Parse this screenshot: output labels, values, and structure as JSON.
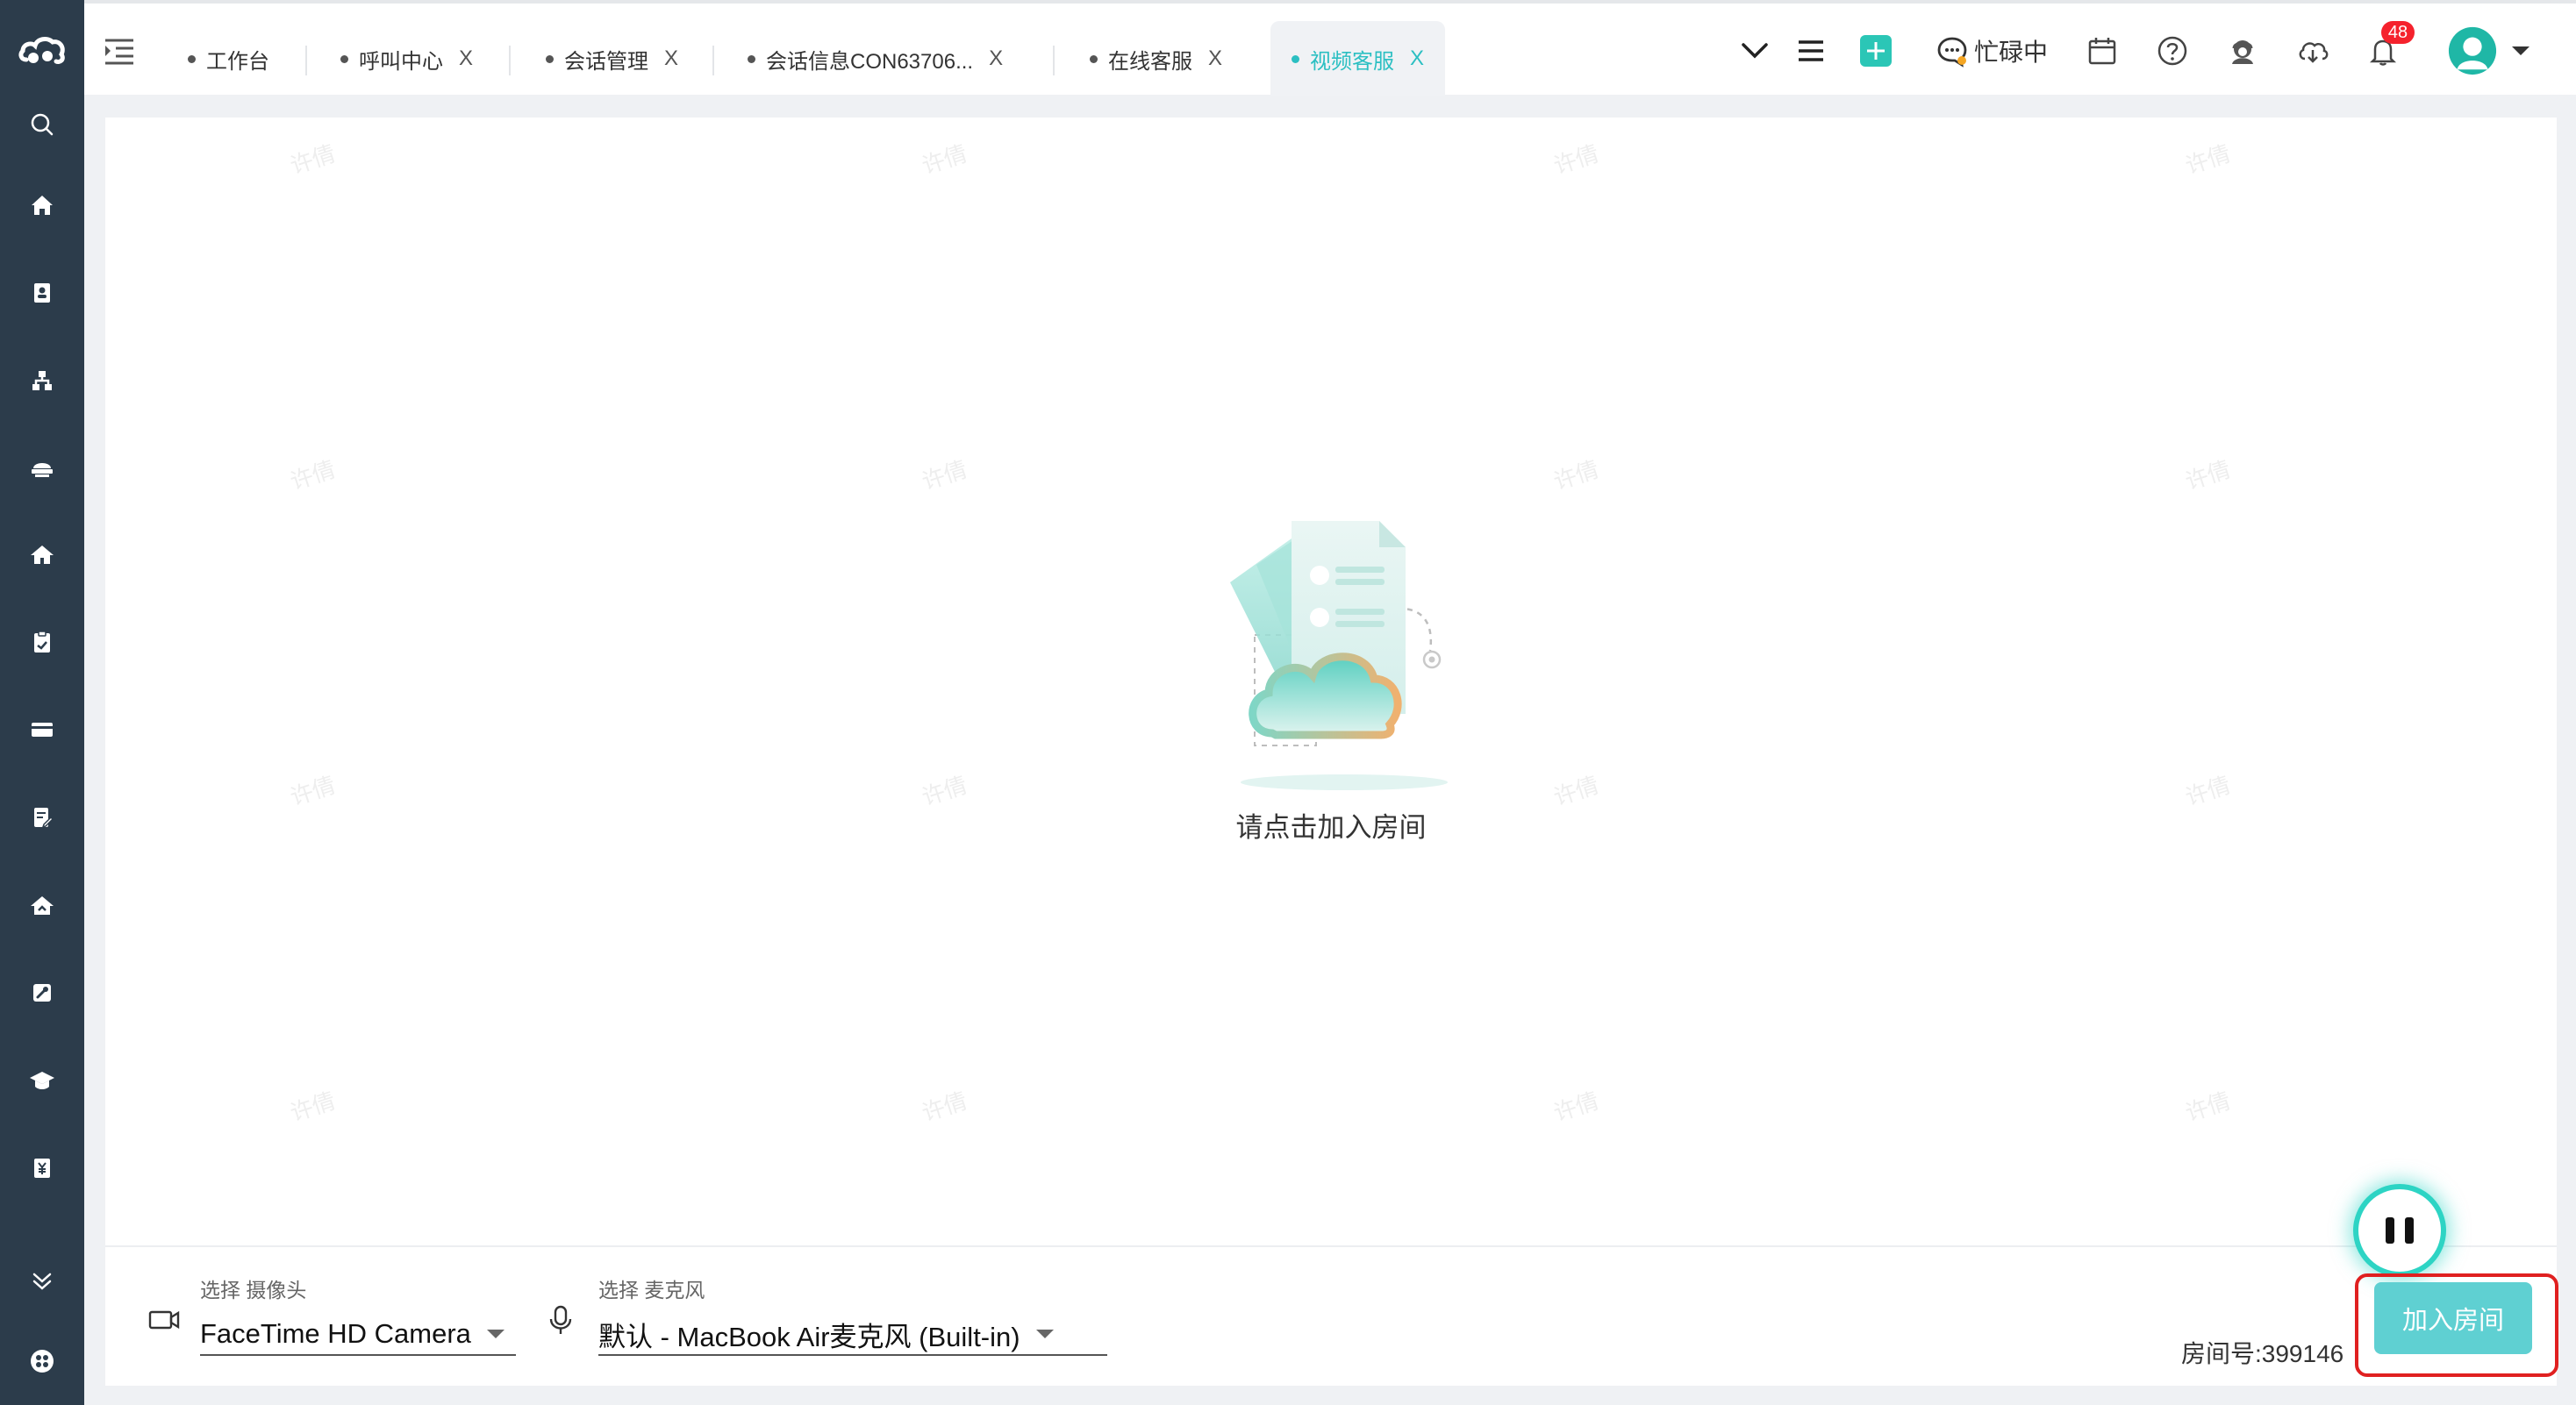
{
  "sidebar": {
    "items": [
      {
        "name": "search-icon"
      },
      {
        "name": "home-icon"
      },
      {
        "name": "contact-card-icon"
      },
      {
        "name": "org-chart-icon"
      },
      {
        "name": "service-desk-icon"
      },
      {
        "name": "house-icon"
      },
      {
        "name": "clipboard-icon"
      },
      {
        "name": "card-icon"
      },
      {
        "name": "edit-document-icon"
      },
      {
        "name": "home-up-icon"
      },
      {
        "name": "tool-icon"
      },
      {
        "name": "graduation-cap-icon"
      },
      {
        "name": "yen-icon"
      }
    ]
  },
  "tabs": [
    {
      "label": "工作台",
      "closable": false
    },
    {
      "label": "呼叫中心",
      "closable": true
    },
    {
      "label": "会话管理",
      "closable": true
    },
    {
      "label": "会话信息CON63706...",
      "closable": true
    },
    {
      "label": "在线客服",
      "closable": true
    },
    {
      "label": "视频客服",
      "closable": true,
      "active": true
    }
  ],
  "tab_close": "X",
  "toolbar": {
    "status_label": "忙碌中",
    "notification_count": "48"
  },
  "watermark": "许倩",
  "main": {
    "empty_text": "请点击加入房间"
  },
  "bottom": {
    "camera_label": "选择 摄像头",
    "camera_value": "FaceTime HD Camera",
    "mic_label": "选择 麦克风",
    "mic_value": "默认 - MacBook Air麦克风 (Built-in)",
    "room_number": "房间号:399146",
    "join_button": "加入房间"
  },
  "colors": {
    "sidebar": "#2c3c4b",
    "accent": "#2bbfc2",
    "join_button": "#5fd0d2",
    "highlight": "#e02020"
  }
}
